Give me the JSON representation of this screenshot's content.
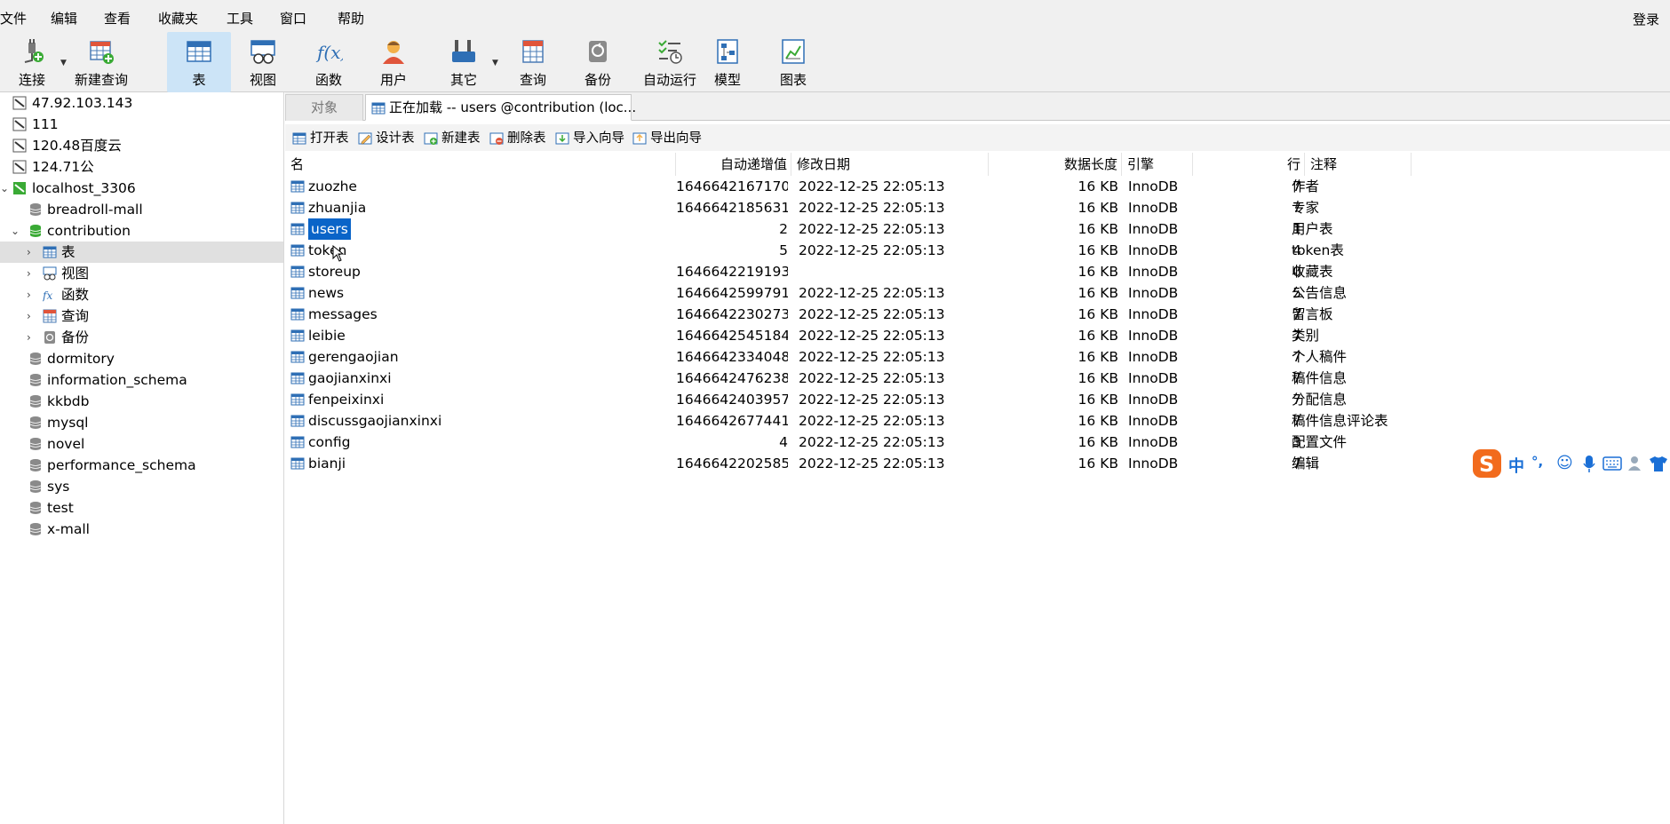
{
  "menu": {
    "items": [
      "文件",
      "编辑",
      "查看",
      "收藏夹",
      "工具",
      "窗口",
      "帮助"
    ],
    "login": "登录"
  },
  "toolbar": {
    "items": [
      {
        "label": "连接",
        "icon": "plug-icon"
      },
      {
        "label": "新建查询",
        "icon": "new-query-icon"
      },
      {
        "label": "表",
        "icon": "table-icon"
      },
      {
        "label": "视图",
        "icon": "view-icon"
      },
      {
        "label": "函数",
        "icon": "function-icon"
      },
      {
        "label": "用户",
        "icon": "user-icon"
      },
      {
        "label": "其它",
        "icon": "tools-icon"
      },
      {
        "label": "查询",
        "icon": "query-icon"
      },
      {
        "label": "备份",
        "icon": "backup-icon"
      },
      {
        "label": "自动运行",
        "icon": "schedule-icon"
      },
      {
        "label": "模型",
        "icon": "model-icon"
      },
      {
        "label": "图表",
        "icon": "chart-icon"
      }
    ]
  },
  "sidebar": {
    "connections": [
      {
        "label": "47.92.103.143"
      },
      {
        "label": "111"
      },
      {
        "label": "120.48百度云"
      },
      {
        "label": "124.71公"
      },
      {
        "label": "localhost_3306"
      }
    ],
    "databases": [
      {
        "label": "breadroll-mall"
      },
      {
        "label": "contribution"
      }
    ],
    "contribution_children": [
      {
        "label": "表"
      },
      {
        "label": "视图"
      },
      {
        "label": "函数"
      },
      {
        "label": "查询"
      },
      {
        "label": "备份"
      }
    ],
    "other_databases": [
      {
        "label": "dormitory"
      },
      {
        "label": "information_schema"
      },
      {
        "label": "kkbdb"
      },
      {
        "label": "mysql"
      },
      {
        "label": "novel"
      },
      {
        "label": "performance_schema"
      },
      {
        "label": "sys"
      },
      {
        "label": "test"
      },
      {
        "label": "x-mall"
      }
    ]
  },
  "tabs": {
    "objects": "对象",
    "active": "正在加载 -- users @contribution (loc..."
  },
  "object_toolbar": {
    "open": "打开表",
    "design": "设计表",
    "new": "新建表",
    "delete": "删除表",
    "import": "导入向导",
    "export": "导出向导"
  },
  "table": {
    "headers": {
      "name": "名",
      "auto_increment": "自动递增值",
      "modified": "修改日期",
      "data_length": "数据长度",
      "engine": "引擎",
      "rows": "行",
      "comment": "注释"
    },
    "rows": [
      {
        "name": "zuozhe",
        "auto": "1646642167170",
        "modified": "2022-12-25 22:05:13",
        "length": "16 KB",
        "engine": "InnoDB",
        "rows": "7",
        "comment": "作者"
      },
      {
        "name": "zhuanjia",
        "auto": "1646642185631",
        "modified": "2022-12-25 22:05:13",
        "length": "16 KB",
        "engine": "InnoDB",
        "rows": "7",
        "comment": "专家"
      },
      {
        "name": "users",
        "auto": "2",
        "modified": "2022-12-25 22:05:13",
        "length": "16 KB",
        "engine": "InnoDB",
        "rows": "1",
        "comment": "用户表"
      },
      {
        "name": "token",
        "auto": "5",
        "modified": "2022-12-25 22:05:13",
        "length": "16 KB",
        "engine": "InnoDB",
        "rows": "4",
        "comment": "token表"
      },
      {
        "name": "storeup",
        "auto": "1646642219193",
        "modified": "",
        "length": "16 KB",
        "engine": "InnoDB",
        "rows": "0",
        "comment": "收藏表"
      },
      {
        "name": "news",
        "auto": "1646642599791",
        "modified": "2022-12-25 22:05:13",
        "length": "16 KB",
        "engine": "InnoDB",
        "rows": "5",
        "comment": "公告信息"
      },
      {
        "name": "messages",
        "auto": "1646642230273",
        "modified": "2022-12-25 22:05:13",
        "length": "16 KB",
        "engine": "InnoDB",
        "rows": "7",
        "comment": "留言板"
      },
      {
        "name": "leibie",
        "auto": "1646642545184",
        "modified": "2022-12-25 22:05:13",
        "length": "16 KB",
        "engine": "InnoDB",
        "rows": "7",
        "comment": "类别"
      },
      {
        "name": "gerengaojian",
        "auto": "1646642334048",
        "modified": "2022-12-25 22:05:13",
        "length": "16 KB",
        "engine": "InnoDB",
        "rows": "7",
        "comment": "个人稿件"
      },
      {
        "name": "gaojianxinxi",
        "auto": "1646642476238",
        "modified": "2022-12-25 22:05:13",
        "length": "16 KB",
        "engine": "InnoDB",
        "rows": "7",
        "comment": "稿件信息"
      },
      {
        "name": "fenpeixinxi",
        "auto": "1646642403957",
        "modified": "2022-12-25 22:05:13",
        "length": "16 KB",
        "engine": "InnoDB",
        "rows": "7",
        "comment": "分配信息"
      },
      {
        "name": "discussgaojianxinxi",
        "auto": "1646642677441",
        "modified": "2022-12-25 22:05:13",
        "length": "16 KB",
        "engine": "InnoDB",
        "rows": "7",
        "comment": "稿件信息评论表"
      },
      {
        "name": "config",
        "auto": "4",
        "modified": "2022-12-25 22:05:13",
        "length": "16 KB",
        "engine": "InnoDB",
        "rows": "3",
        "comment": "配置文件"
      },
      {
        "name": "bianji",
        "auto": "1646642202585",
        "modified": "2022-12-25 22:05:13",
        "length": "16 KB",
        "engine": "InnoDB",
        "rows": "7",
        "comment": "编辑"
      }
    ]
  },
  "ime": {
    "lang": "中",
    "punct": "°,"
  },
  "colors": {
    "selection": "#0a64c8",
    "active_tool": "#cce4f7",
    "connection_green": "#3aaa35",
    "ime_orange": "#f26b1d"
  }
}
